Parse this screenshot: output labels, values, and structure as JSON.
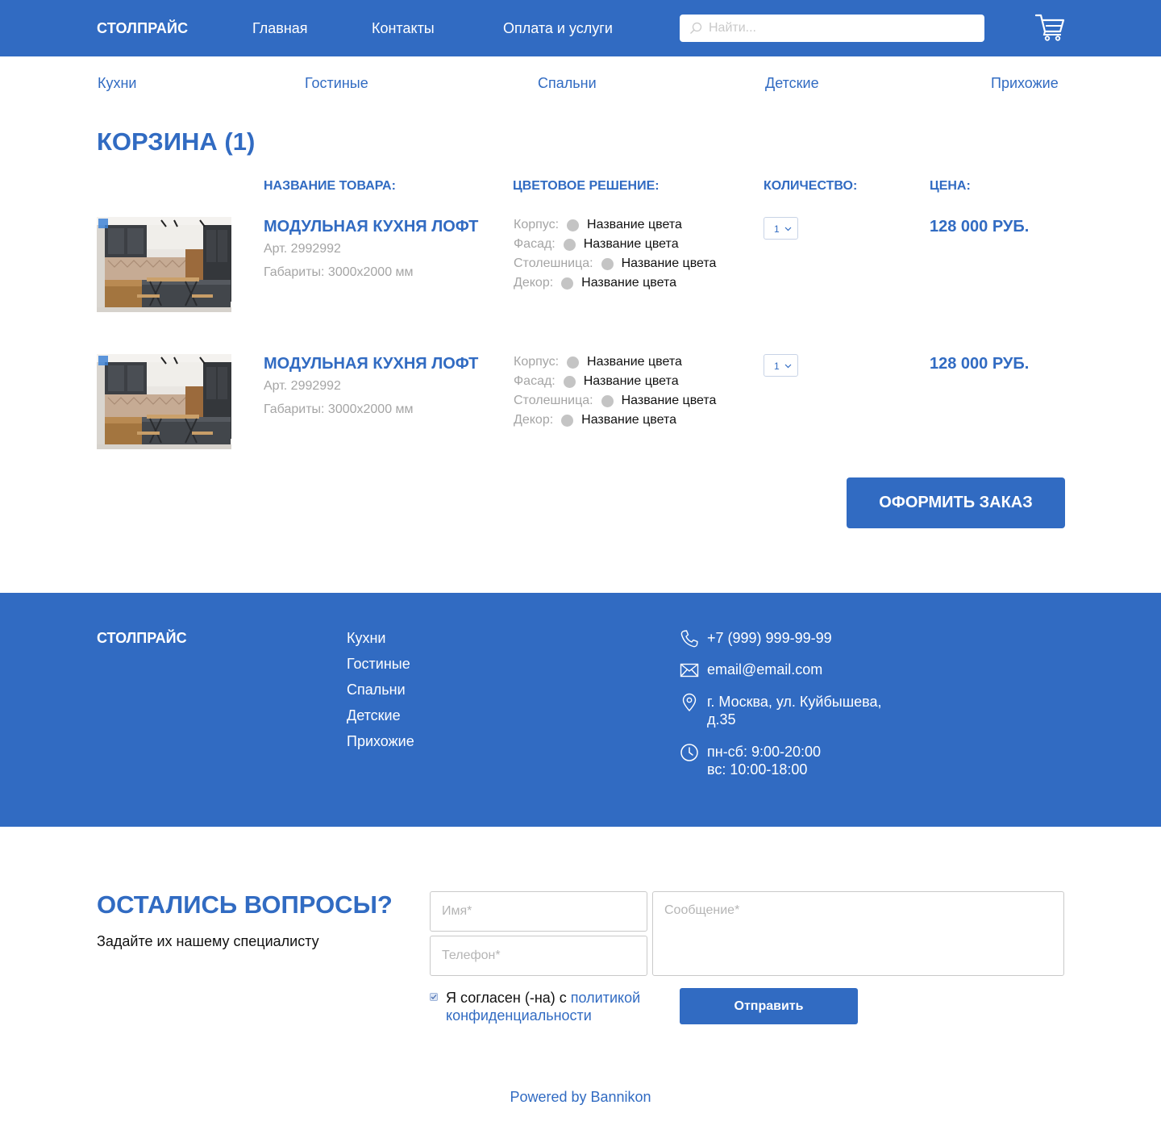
{
  "colors": {
    "brand": "#316bc2",
    "muted": "#a5a5a5",
    "swatch": "#c4c4c4"
  },
  "header": {
    "logo": "СТОЛПРАЙС",
    "nav": [
      "Главная",
      "Контакты",
      "Оплата и услуги"
    ],
    "search_placeholder": "Найти...",
    "search_icon": "search-icon",
    "cart_icon": "cart-icon"
  },
  "categories": [
    "Кухни",
    "Гостиные",
    "Спальни",
    "Детские",
    "Прихожие"
  ],
  "cart": {
    "title": "КОРЗИНА (1)",
    "columns": {
      "name": "НАЗВАНИЕ ТОВАРА:",
      "color": "ЦВЕТОВОЕ РЕШЕНИЕ:",
      "qty": "КОЛИЧЕСТВО:",
      "price": "ЦЕНА:"
    },
    "items": [
      {
        "name": "МОДУЛЬНАЯ КУХНЯ ЛОФТ",
        "article": "Арт. 2992992",
        "dimensions": "Габариты: 3000x2000 мм",
        "options": [
          {
            "label": "Корпус:",
            "value": "Название цвета"
          },
          {
            "label": "Фасад:",
            "value": "Название цвета"
          },
          {
            "label": "Столешница:",
            "value": "Название цвета"
          },
          {
            "label": "Декор:",
            "value": "Название цвета"
          }
        ],
        "qty": "1",
        "price": "128 000 РУБ."
      },
      {
        "name": "МОДУЛЬНАЯ КУХНЯ ЛОФТ",
        "article": "Арт. 2992992",
        "dimensions": "Габариты: 3000x2000 мм",
        "options": [
          {
            "label": "Корпус:",
            "value": "Название цвета"
          },
          {
            "label": "Фасад:",
            "value": "Название цвета"
          },
          {
            "label": "Столешница:",
            "value": "Название цвета"
          },
          {
            "label": "Декор:",
            "value": "Название цвета"
          }
        ],
        "qty": "1",
        "price": "128 000 РУБ."
      }
    ],
    "order_button": "ОФОРМИТЬ ЗАКАЗ"
  },
  "footer": {
    "logo": "СТОЛПРАЙС",
    "links": [
      "Кухни",
      "Гостиные",
      "Спальни",
      "Детские",
      "Прихожие"
    ],
    "phone": "+7 (999) 999-99-99",
    "email": "email@email.com",
    "address_line1": "г. Москва, ул. Куйбышева,",
    "address_line2": "д.35",
    "hours_line1": "пн-сб: 9:00-20:00",
    "hours_line2": "вс: 10:00-18:00"
  },
  "questions": {
    "title": "ОСТАЛИСЬ ВОПРОСЫ?",
    "subtitle": "Задайте их нашему специалисту",
    "name_placeholder": "Имя*",
    "phone_placeholder": "Телефон*",
    "message_placeholder": "Сообщение*",
    "consent_text": "Я согласен (-на) с ",
    "consent_link": "политикой конфиденциальности",
    "consent_checked": true,
    "send_button": "Отправить"
  },
  "powered_by": "Powered by Bannikon"
}
